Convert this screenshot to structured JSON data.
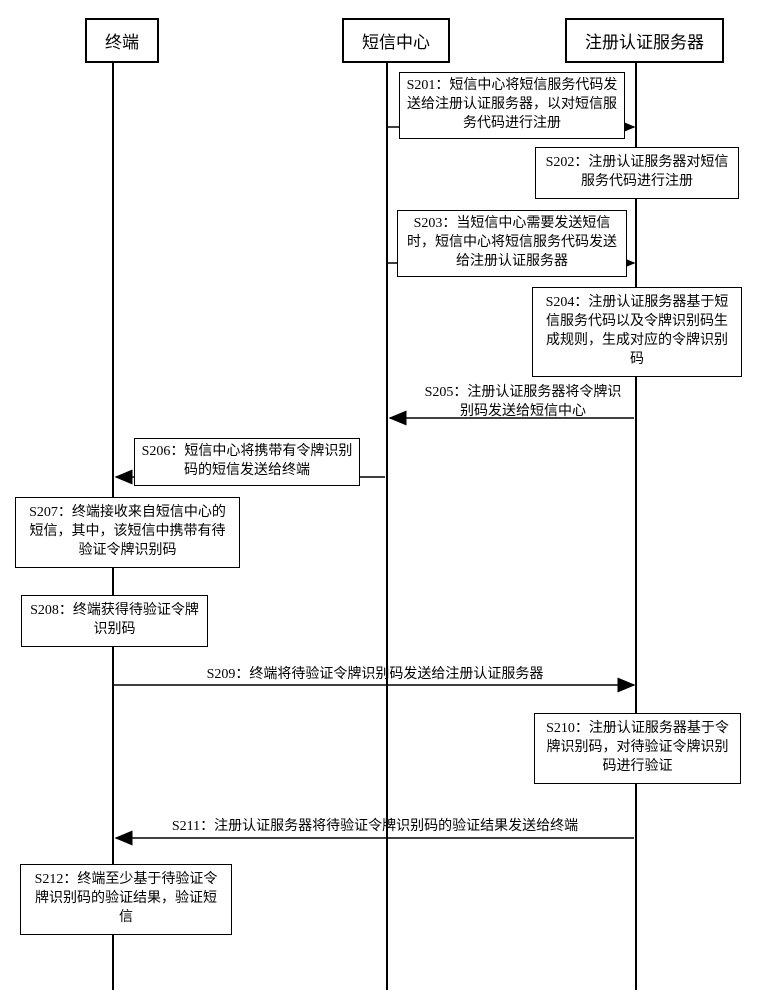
{
  "participants": {
    "terminal": "终端",
    "smsCenter": "短信中心",
    "authServer": "注册认证服务器"
  },
  "steps": {
    "s201": "S201：短信中心将短信服务代码发送给注册认证服务器，以对短信服务代码进行注册",
    "s202": "S202：注册认证服务器对短信服务代码进行注册",
    "s203": "S203：当短信中心需要发送短信时，短信中心将短信服务代码发送给注册认证服务器",
    "s204": "S204：注册认证服务器基于短信服务代码以及令牌识别码生成规则，生成对应的令牌识别码",
    "s205": "S205：注册认证服务器将令牌识别码发送给短信中心",
    "s206": "S206：短信中心将携带有令牌识别码的短信发送给终端",
    "s207": "S207：终端接收来自短信中心的短信，其中，该短信中携带有待验证令牌识别码",
    "s208": "S208：终端获得待验证令牌识别码",
    "s209": "S209：终端将待验证令牌识别码发送给注册认证服务器",
    "s210": "S210：注册认证服务器基于令牌识别码，对待验证令牌识别码进行验证",
    "s211": "S211：注册认证服务器将待验证令牌识别码的验证结果发送给终端",
    "s212": "S212：终端至少基于待验证令牌识别码的验证结果，验证短信"
  }
}
